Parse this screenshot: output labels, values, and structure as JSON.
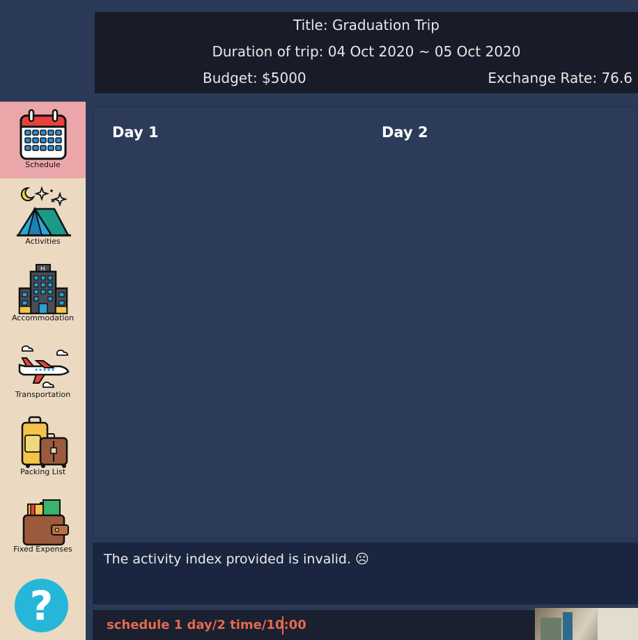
{
  "header": {
    "title": "Title: Graduation Trip",
    "duration": "Duration of trip: 04 Oct 2020 ~ 05 Oct 2020",
    "budget": "Budget: $5000",
    "exchange_rate": "Exchange Rate: 76.6"
  },
  "sidebar": {
    "items": [
      {
        "label": "Schedule",
        "icon": "calendar-icon"
      },
      {
        "label": "Activities",
        "icon": "tent-icon"
      },
      {
        "label": "Accommodation",
        "icon": "hotel-icon"
      },
      {
        "label": "Transportation",
        "icon": "airplane-icon"
      },
      {
        "label": "Packing List",
        "icon": "luggage-icon"
      },
      {
        "label": "Fixed Expenses",
        "icon": "wallet-icon"
      }
    ],
    "help": {
      "label": "?",
      "icon": "help-icon"
    }
  },
  "schedule": {
    "days": [
      "Day 1",
      "Day 2"
    ]
  },
  "result": {
    "message": "The activity index provided is invalid. ☹"
  },
  "command": {
    "value": "schedule 1 day/2 time/10:00"
  },
  "colors": {
    "accent_active": "#eba6aa",
    "sidebar_bg": "#ebd9c2",
    "command_text": "#e56a4e",
    "help_button": "#26b6d8"
  }
}
